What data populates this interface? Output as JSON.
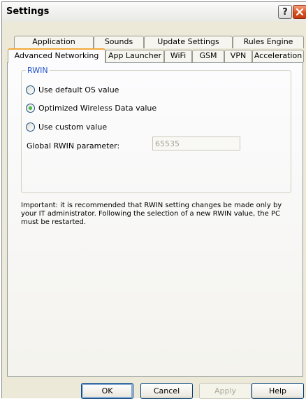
{
  "window": {
    "title": "Settings"
  },
  "titlebar": {
    "help_label": "?"
  },
  "tabs_row1": [
    "Application",
    "Sounds",
    "Update Settings",
    "Rules Engine"
  ],
  "tabs_row2": [
    "Advanced Networking",
    "App Launcher",
    "WiFi",
    "GSM",
    "VPN",
    "Acceleration"
  ],
  "active_tab": "Advanced Networking",
  "rwin": {
    "group_title": "RWIN",
    "options": [
      {
        "label": "Use default OS value",
        "selected": false
      },
      {
        "label": "Optimized Wireless Data value",
        "selected": true
      },
      {
        "label": "Use custom value",
        "selected": false
      }
    ],
    "global_label": "Global RWIN parameter:",
    "global_value": "65535"
  },
  "notice": "Important:  it is recommended that RWIN setting changes be made only by your IT administrator.   Following the selection of a new RWIN value, the PC must be restarted.",
  "buttons": {
    "ok": "OK",
    "cancel": "Cancel",
    "apply": "Apply",
    "help": "Help"
  },
  "colors": {
    "accent_tab": "#f2a83a",
    "group_title": "#2050c8",
    "close_button": "#d8501e",
    "radio_selected": "#21a121"
  }
}
